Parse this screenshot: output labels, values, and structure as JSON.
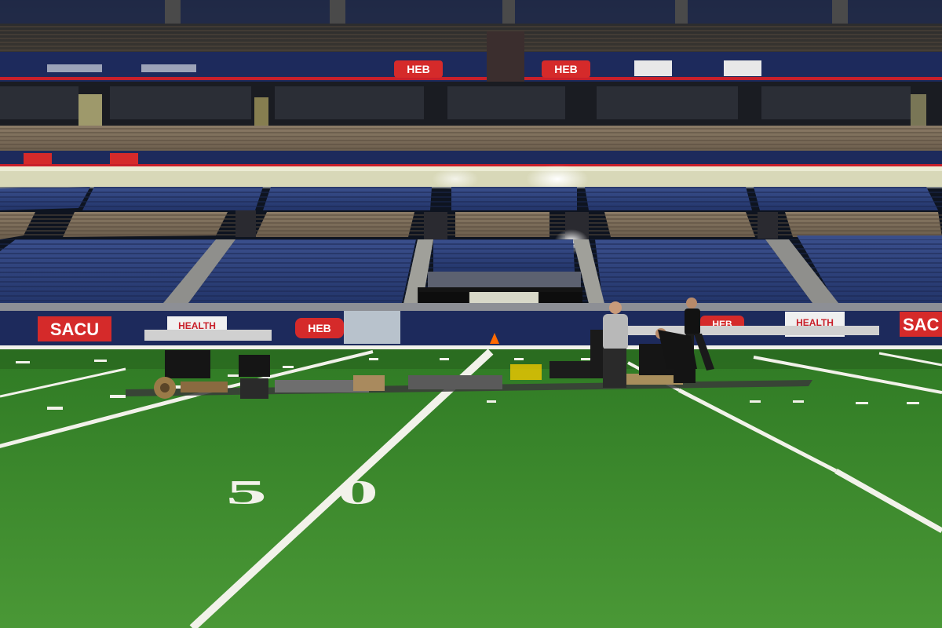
{
  "scene": {
    "yard_number": "50",
    "sponsor_signs": {
      "upper_ring": [
        "HEB",
        "HEB"
      ],
      "upper_logo_a": "",
      "lower_ring_left": "SACU",
      "lower_ring_right": "SAC",
      "health_left": "HEALTH",
      "health_right": "HEALTH",
      "heb_left": "HEB",
      "heb_right": "HEB"
    },
    "colors": {
      "turf": "#3f8a2e",
      "turf_dark": "#2f6f22",
      "seats_blue": "#2a3f7a",
      "seats_tan": "#7a6a58",
      "sign_red": "#c8202a",
      "stripe_white": "#f2f2ea"
    }
  }
}
